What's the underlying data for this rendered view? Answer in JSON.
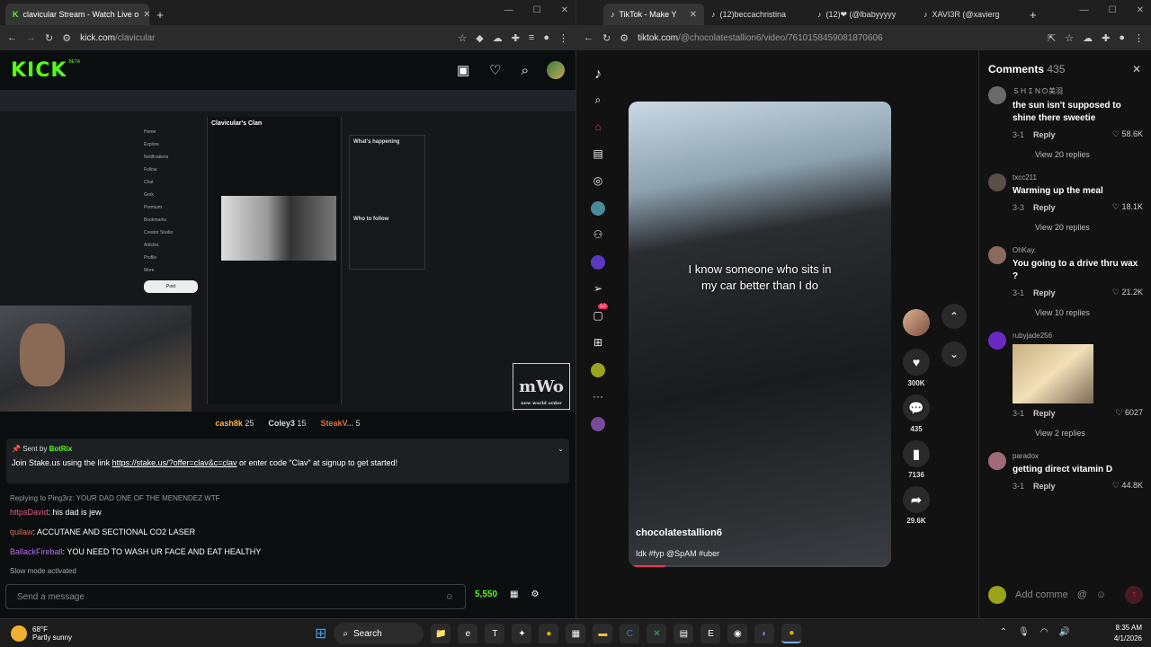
{
  "left_browser": {
    "tab_title": "clavicular Stream - Watch Live o",
    "url_domain": "kick.com",
    "url_path": "/clavicular"
  },
  "kick": {
    "logo": "KICK",
    "logo_beta": "BETA",
    "gifters": [
      {
        "name": "cash8k",
        "count": "25"
      },
      {
        "name": "Coley3",
        "count": "15"
      },
      {
        "name": "SteakV...",
        "count": "5"
      }
    ],
    "pinned": {
      "sent_by_label": "Sent by",
      "sender": "BotRix",
      "text_before": "Join Stake.us using the link ",
      "link": "https://stake.us/?offer=clav&c=clav",
      "text_after": " or enter code “Clav” at signup to get started!"
    },
    "reply_line": "Replying to Ping3rz: YOUR DAD ONE OF THE MENENDEZ WTF",
    "messages": [
      {
        "user": "httpsDavid",
        "text": "his dad is jew"
      },
      {
        "user": "qullaw",
        "text": "ACCUTANE AND SECTIONAL CO2 LASER"
      },
      {
        "user": "BallackFireball",
        "text": "YOU NEED TO WASH UR FACE AND EAT HEALTHY"
      }
    ],
    "slow_mode": "Slow mode activated",
    "send_placeholder": "Send a message",
    "points": "5,550"
  },
  "embedded_screen": {
    "feed_title": "Clavicular's Clan",
    "side_items": [
      "Home",
      "Explore",
      "Notifications",
      "Follow",
      "Chat",
      "Grok",
      "Premium",
      "Bookmarks",
      "Creator Studio",
      "Articles",
      "Profile",
      "More"
    ],
    "post_button": "Post",
    "whats_happening": "What's happening",
    "who_to_follow": "Who to follow",
    "overlay_logo": "mWo",
    "overlay_sub": "new world order"
  },
  "right_browser": {
    "tabs": [
      {
        "title": "TikTok - Make Y"
      },
      {
        "title": "(12)beccachristina"
      },
      {
        "title": "(12)❤ (@lbabyyyyy"
      },
      {
        "title": "XAVI3R (@xavierg"
      }
    ],
    "url_domain": "tiktok.com",
    "url_path": "/@chocolatestallion6/video/7610158459081870606"
  },
  "tiktok": {
    "caption": "I know someone who sits in my car better than I do",
    "username": "chocolatestallion6",
    "description": "Idk #fyp @SpAM #uber",
    "inbox_badge": "12",
    "likes": "300K",
    "comments_count": "435",
    "saves": "7136",
    "shares": "29.6K",
    "comments_header": "Comments",
    "comments_total": "435",
    "comments": [
      {
        "user": "ＳＨＩＮＯ美羽",
        "text": "the sun isn't supposed to shine there sweetie",
        "date": "3-1",
        "likes": "58.6K",
        "replies": "View 20 replies"
      },
      {
        "user": "txcc211",
        "text": "Warming up the meal",
        "date": "3-3",
        "likes": "18.1K",
        "replies": "View 20 replies"
      },
      {
        "user": "OhKay.",
        "text": "You going to a drive thru wax ?",
        "date": "3-1",
        "likes": "21.2K",
        "replies": "View 10 replies"
      },
      {
        "user": "rubyjade256",
        "text": "",
        "date": "3-1",
        "likes": "6027",
        "replies": "View 2 replies"
      },
      {
        "user": "paradox",
        "text": "getting direct vitamin D",
        "date": "3-1",
        "likes": "44.8K",
        "replies": ""
      }
    ],
    "reply_label": "Reply",
    "add_comment": "Add comme"
  },
  "taskbar": {
    "temp": "68°F",
    "weather": "Partly sunny",
    "search": "Search",
    "time": "8:35 AM",
    "date": "4/1/2026"
  }
}
